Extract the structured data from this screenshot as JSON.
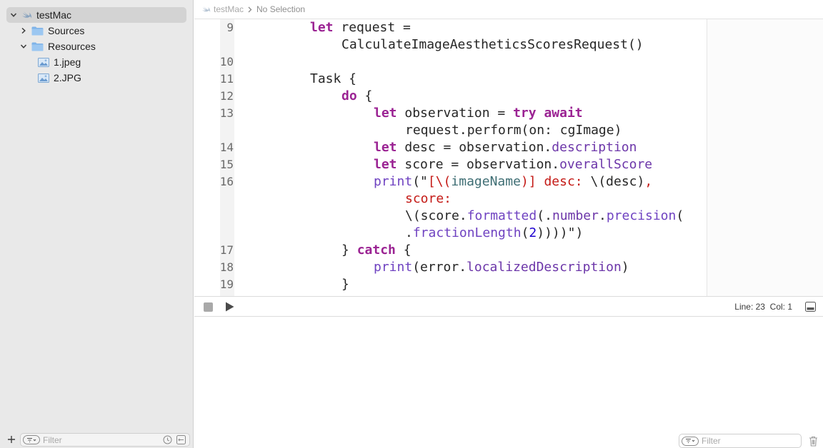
{
  "sidebar": {
    "items": [
      {
        "label": "testMac",
        "icon": "swift-icon",
        "expanded": true
      },
      {
        "label": "Sources",
        "icon": "folder-icon",
        "expanded": false
      },
      {
        "label": "Resources",
        "icon": "folder-icon",
        "expanded": true
      },
      {
        "label": "1.jpeg",
        "icon": "image-file-icon"
      },
      {
        "label": "2.JPG",
        "icon": "image-file-icon"
      }
    ],
    "filter_placeholder": "Filter"
  },
  "jumpbar": {
    "project": "testMac",
    "selection": "No Selection"
  },
  "editor": {
    "line_numbers": [
      "9",
      "10",
      "11",
      "12",
      "13",
      "14",
      "15",
      "16",
      "17",
      "18",
      "19"
    ]
  },
  "debug": {
    "line_col": "Line: 23  Col: 1"
  },
  "console": {
    "filter_placeholder": "Filter"
  },
  "colors": {
    "keyword": "#9b2393",
    "property": "#6c36a9",
    "string": "#c41a16",
    "sidebar_bg": "#e9e9e9",
    "folder": "#7fb3e8"
  }
}
